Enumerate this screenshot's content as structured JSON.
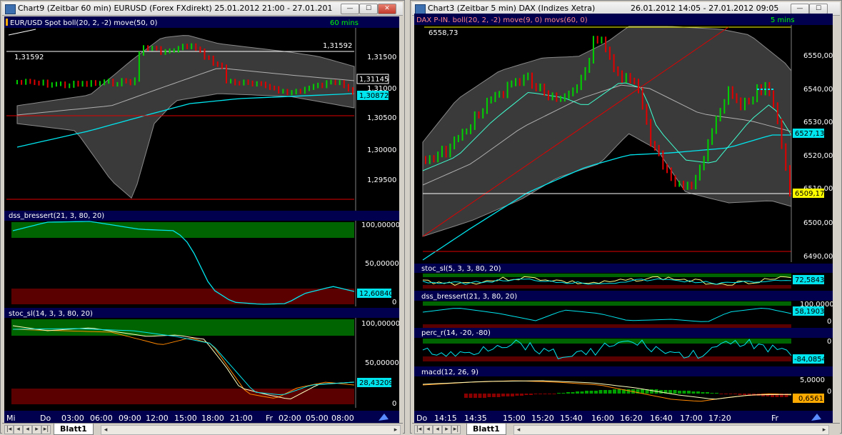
{
  "left_window": {
    "title": "Chart9 (Zeitbar 60 min)  EURUSD (Forex FXdirekt) 25.01.2012 21:00 - 27.01.2012 09...",
    "buttons": {
      "minimize": "—",
      "maximize": "☐",
      "close": "✕"
    },
    "price_pane": {
      "indicator_label": "EUR/USD Spot  boll(20, 2, -2)  move(50, 0)",
      "interval": "60 mins",
      "hline_label": "1,31592",
      "hline_label2": "1,31592",
      "axis_ticks": [
        "1,31500",
        "1,31000",
        "1,30500",
        "1,30000",
        "1,29500"
      ],
      "value_tags": [
        {
          "text": "1,31145",
          "color": "#ffffff",
          "bg": "#000000"
        },
        {
          "text": "1,30872",
          "color": "#000000",
          "bg": "#00e5ee"
        }
      ]
    },
    "pane2": {
      "label": "dss_bressert(21, 3, 80, 20)",
      "ticks": [
        "100,00000",
        "50,00000",
        "0"
      ],
      "value_tag": "12,60840"
    },
    "pane3": {
      "label": "stoc_sl(14, 3, 3, 80, 20)",
      "ticks": [
        "100,00000",
        "50,00000",
        "0"
      ],
      "value_tag": "28,43209"
    },
    "time_axis": [
      "Mi",
      "Do",
      "03:00",
      "06:00",
      "09:00",
      "12:00",
      "15:00",
      "18:00",
      "21:00",
      "Fr",
      "02:00",
      "05:00",
      "08:00"
    ],
    "sheet_tab": "Blatt1"
  },
  "right_window": {
    "title": "Chart3 (Zeitbar 5 min)  DAX (Indizes Xetra)",
    "date_range": "26.01.2012 14:05 - 27.01.2012 09:05",
    "buttons": {
      "minimize": "—",
      "maximize": "☐",
      "close": "✕"
    },
    "price_pane": {
      "indicator_label": "DAX P-IN.  boll(20, 2, -2)  move(9, 0)  movs(60, 0)",
      "interval": "5 mins",
      "high_label": "6558,73",
      "axis_ticks": [
        "6550,00",
        "6540,00",
        "6530,00",
        "6520,00",
        "6510,00",
        "6500,00",
        "6490,00"
      ],
      "value_tags": [
        {
          "text": "6527,13",
          "color": "#000000",
          "bg": "#00e5ee"
        },
        {
          "text": "6509,17",
          "color": "#000000",
          "bg": "#ffff00"
        }
      ]
    },
    "pane2": {
      "label": "stoc_sl(5, 3, 3, 80, 20)",
      "value_tag": "72,5843"
    },
    "pane3": {
      "label": "dss_bressert(21, 3, 80, 20)",
      "ticks": [
        "100,0000",
        "0"
      ],
      "value_tag": "58,1903"
    },
    "pane4": {
      "label": "perc_r(14, -20, -80)",
      "ticks": [
        "0"
      ],
      "value_tag": "-84,0854"
    },
    "pane5": {
      "label": "macd(12, 26, 9)",
      "ticks": [
        "5,0000",
        "0"
      ],
      "value_tag": "0,6561"
    },
    "time_axis": [
      "Do",
      "14:15",
      "14:35",
      "15:00",
      "15:20",
      "15:40",
      "16:00",
      "16:20",
      "16:40",
      "17:00",
      "17:20",
      "Fr"
    ],
    "sheet_tab": "Blatt1"
  },
  "colors": {
    "bull": "#00d000",
    "bear": "#e00000",
    "band": "#3a3a3a",
    "ma_cyan": "#00e5ee",
    "ma_gray": "#b0b0b0",
    "ob_green": "#006400",
    "os_red": "#5a0000",
    "label_blue": "#00004e"
  }
}
